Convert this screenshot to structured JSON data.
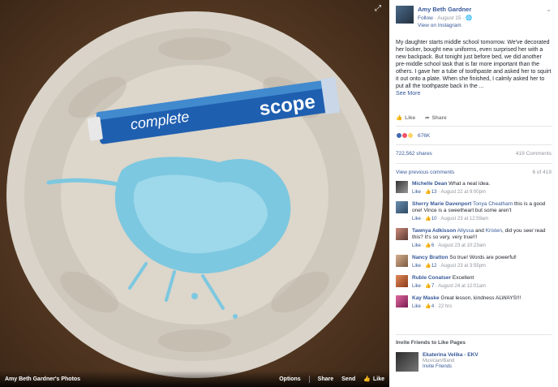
{
  "photo": {
    "owner_label": "Amy Beth Gardner's Photos",
    "options_label": "Options",
    "share_label": "Share",
    "send_label": "Send",
    "like_label": "Like",
    "tube_brand": "complete",
    "tube_brand2": "scope"
  },
  "post": {
    "author": "Amy Beth Gardner",
    "follow_label": "Follow",
    "date": "August 15",
    "via": "View on Instagram",
    "text": "My daughter starts middle school tomorrow. We've decorated her locker, bought new uniforms, even surprised her with a new backpack. But tonight just before bed, we did another pre-middle school task that is far more important than the others. I gave her a tube of toothpaste and asked her to squirt it out onto a plate. When she finished, I calmly asked her to put all the toothpaste back in the ...",
    "see_more": "See More",
    "like_action": "Like",
    "share_action": "Share",
    "reaction_count": "676K",
    "shares": "722,562 shares",
    "comments_count": "419 Comments",
    "view_previous": "View previous comments",
    "comment_position": "6 of 419"
  },
  "comments": [
    {
      "name": "Michelle Dean",
      "text": "What a neat idea.",
      "like": "Like",
      "likes": "13",
      "time": "August 22 at 9:00pm"
    },
    {
      "name": "Sherry Marie Davenport",
      "tag": "Tonya Cheatham",
      "text": "this is a good one! Vince is a sweetheart but some aren't",
      "like": "Like",
      "likes": "10",
      "time": "August 23 at 12:59am"
    },
    {
      "name": "Tawnya Adkisson",
      "tag": "Allyssa",
      "tag2": "Kristen",
      "text": ", did you see/ read this? It's so very, very true!!!",
      "and": "and",
      "like": "Like",
      "likes": "6",
      "time": "August 23 at 10:23am"
    },
    {
      "name": "Nancy Bratton",
      "text": "So true! Words are powerful!",
      "like": "Like",
      "likes": "12",
      "time": "August 23 at 3:55pm"
    },
    {
      "name": "Ruble Conatser",
      "text": "Excellent",
      "like": "Like",
      "likes": "7",
      "time": "August 24 at 12:01am"
    },
    {
      "name": "Kay Maske",
      "text": "Great lesson, kindness ALWAYS!!!",
      "like": "Like",
      "likes": "4",
      "time": "22 hrs"
    }
  ],
  "invite": {
    "title": "Invite Friends to Like Pages",
    "page_name": "Ekaterina Velika - EKV",
    "category": "Musician/Band",
    "invite_label": "Invite Friends"
  },
  "colors": {
    "link": "#365899",
    "muted": "#90949c",
    "toothpaste": "#7cc8e0",
    "tube": "#1f5fb0"
  },
  "icons": [
    "expand-icon",
    "globe-icon",
    "chevron-down-icon",
    "thumbs-up-icon",
    "share-icon"
  ]
}
